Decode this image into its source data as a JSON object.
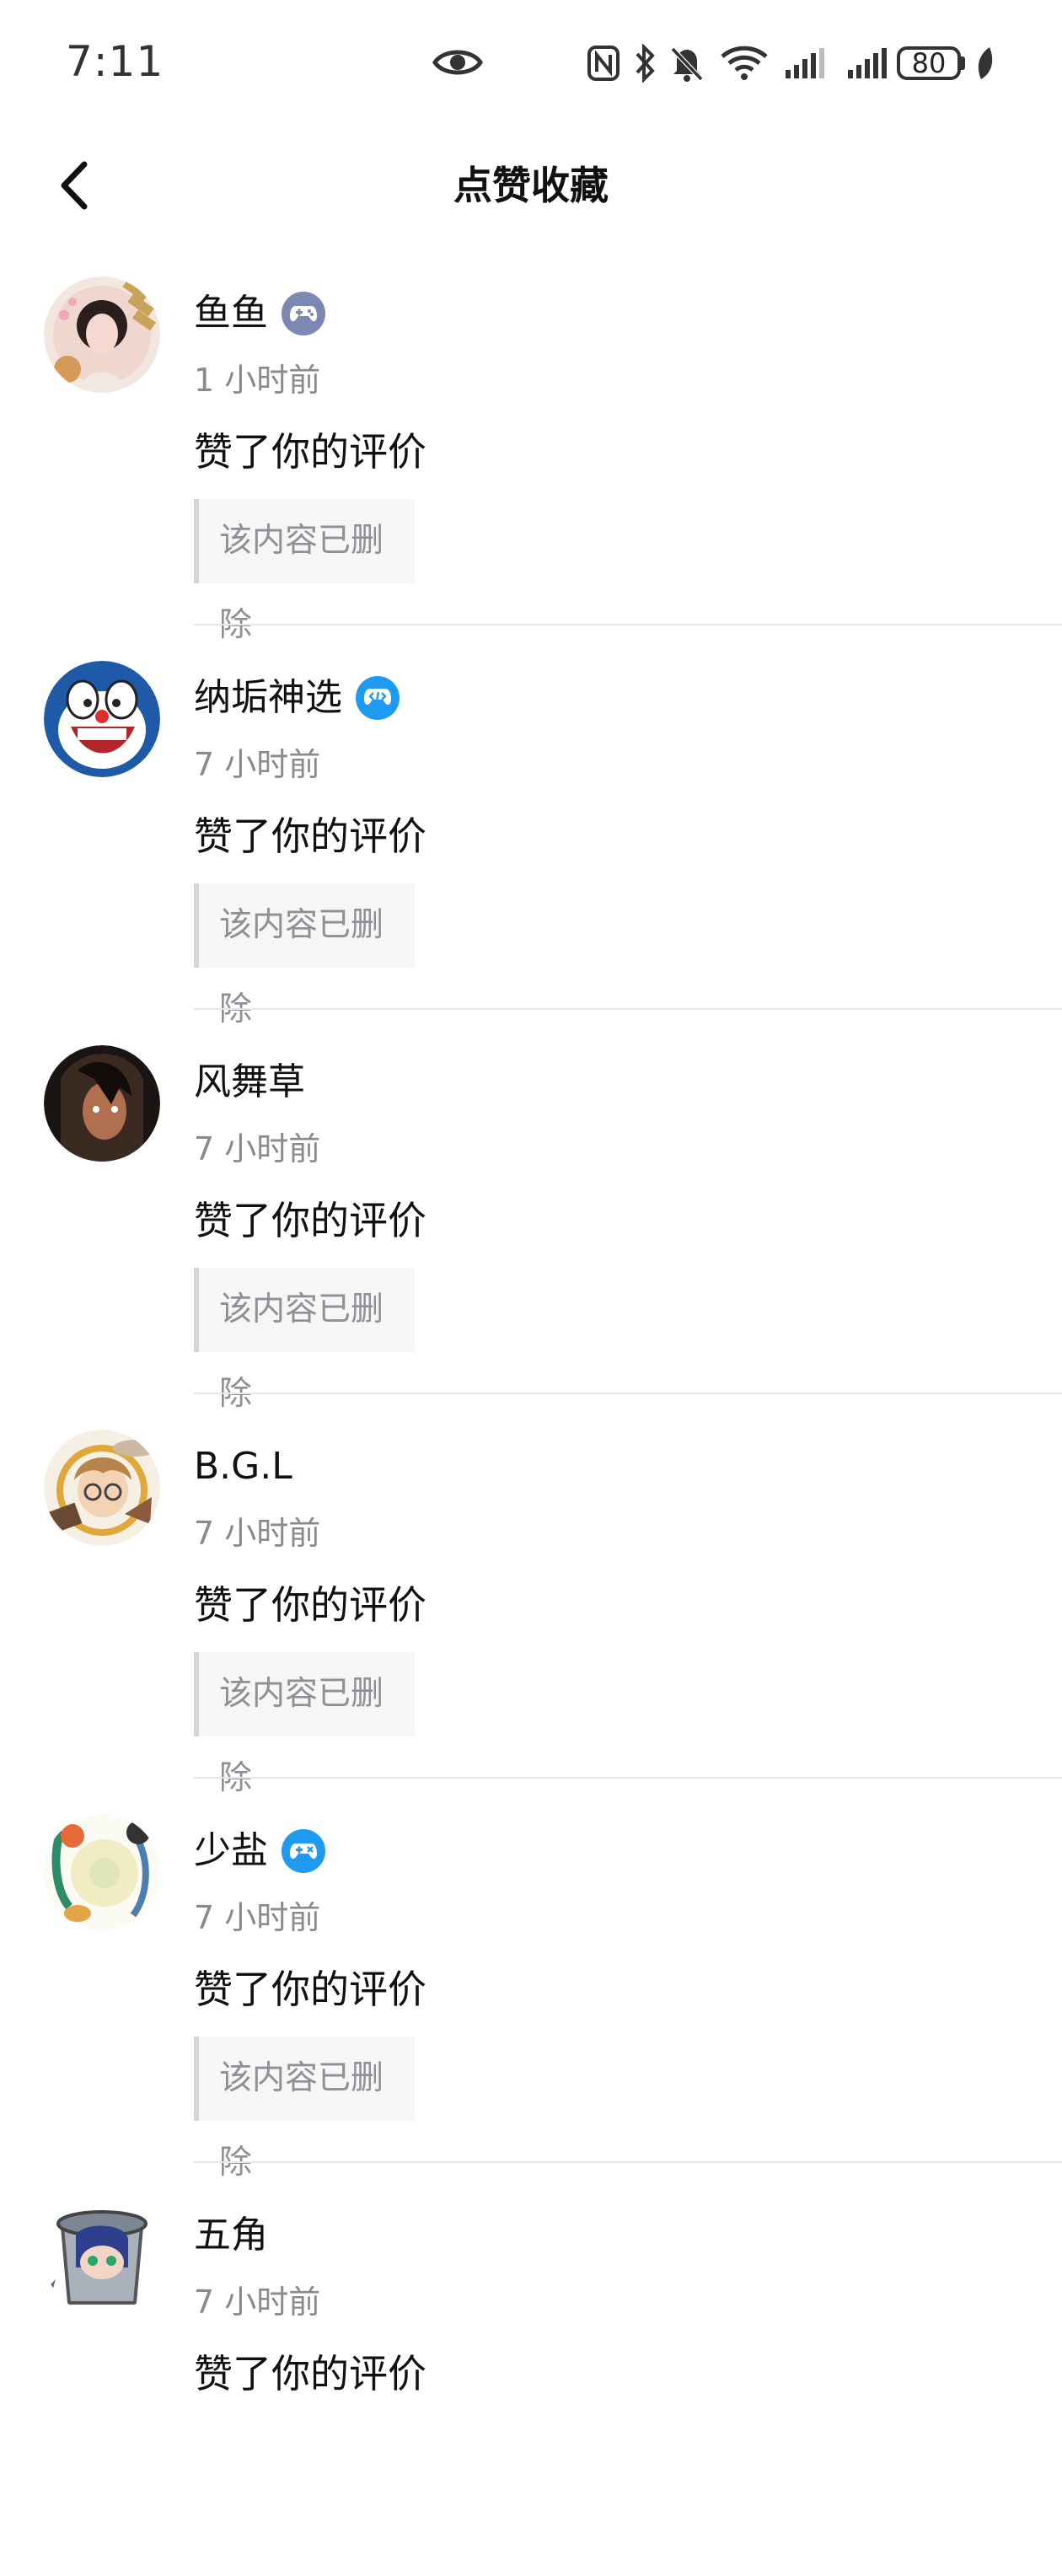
{
  "status_bar": {
    "time": "7:11",
    "battery": "80",
    "icons": [
      "eye-icon",
      "nfc-icon",
      "bluetooth-icon",
      "mute-icon",
      "wifi-icon",
      "signal-icon",
      "signal-icon",
      "battery-icon",
      "leaf-icon"
    ]
  },
  "nav": {
    "title": "点赞收藏",
    "back_icon": "chevron-left-icon"
  },
  "colors": {
    "badge_gray": "#7c88b4",
    "badge_blue": "#1e9bf0",
    "divider": "#e7e7ea",
    "quote_bg": "#f6f6f7"
  },
  "items": [
    {
      "name": "鱼鱼",
      "badge": "gamepad-badge-icon",
      "badge_color": "#7c88b4",
      "time": "1 小时前",
      "action": "赞了你的评价",
      "quote": "该内容已删除"
    },
    {
      "name": "纳垢神选",
      "badge": "developer-badge-icon",
      "badge_color": "#1e9bf0",
      "time": "7 小时前",
      "action": "赞了你的评价",
      "quote": "该内容已删除"
    },
    {
      "name": "风舞草",
      "badge": "",
      "time": "7 小时前",
      "action": "赞了你的评价",
      "quote": "该内容已删除"
    },
    {
      "name": "B.G.L",
      "badge": "",
      "time": "7 小时前",
      "action": "赞了你的评价",
      "quote": "该内容已删除"
    },
    {
      "name": "少盐",
      "badge": "gamepad-badge-icon",
      "badge_color": "#1e9bf0",
      "time": "7 小时前",
      "action": "赞了你的评价",
      "quote": "该内容已删除"
    },
    {
      "name": "五角",
      "badge": "",
      "time": "7 小时前",
      "action": "赞了你的评价",
      "quote": ""
    }
  ]
}
